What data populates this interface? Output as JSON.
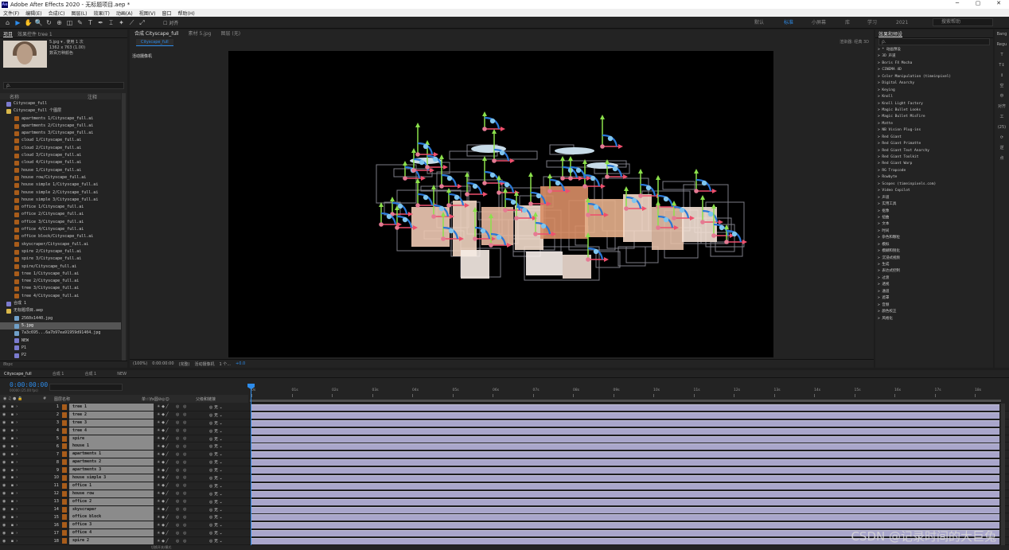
{
  "app": {
    "title": "Adobe After Effects 2020 - 无标题项目.aep *",
    "window_buttons": [
      "─",
      "▢",
      "✕"
    ]
  },
  "menu": [
    "文件(F)",
    "编辑(E)",
    "合成(C)",
    "图层(L)",
    "效果(T)",
    "动画(A)",
    "视图(V)",
    "窗口",
    "帮助(H)"
  ],
  "toolbar": {
    "tools": [
      "⌂",
      "▶",
      "✋",
      "🔍",
      "↻",
      "⊕",
      "◫",
      "✎",
      "T",
      "✒",
      "⌶",
      "✦",
      "⟋",
      "⤢"
    ],
    "extras": [
      "对齐"
    ],
    "workspaces": [
      "默认",
      "标准",
      "小屏幕",
      "库",
      "学习",
      "2021"
    ],
    "active_workspace": "标准",
    "search_help": "搜索帮助"
  },
  "project": {
    "tabs": [
      "项目",
      "效果控件 tree 1"
    ],
    "item_name": "5.jpg",
    "item_meta": [
      "5.jpg ▾ , 使用 1 次",
      "1362 x 763 (1.00)",
      "",
      "数百万种颜色"
    ],
    "search_placeholder": "ρ.",
    "col_name": "名称",
    "col_comment": "注释",
    "items": [
      {
        "label": "Cityscape_full",
        "type": "comp",
        "indent": 0
      },
      {
        "label": "Cityscape_full 个图层",
        "type": "folder",
        "indent": 0
      },
      {
        "label": "apartments 1/Cityscape_full.ai",
        "type": "ai",
        "indent": 1
      },
      {
        "label": "apartments 2/Cityscape_full.ai",
        "type": "ai",
        "indent": 1
      },
      {
        "label": "apartments 3/Cityscape_full.ai",
        "type": "ai",
        "indent": 1
      },
      {
        "label": "cloud 1/Cityscape_full.ai",
        "type": "ai",
        "indent": 1
      },
      {
        "label": "cloud 2/Cityscape_full.ai",
        "type": "ai",
        "indent": 1
      },
      {
        "label": "cloud 3/Cityscape_full.ai",
        "type": "ai",
        "indent": 1
      },
      {
        "label": "cloud 4/Cityscape_full.ai",
        "type": "ai",
        "indent": 1
      },
      {
        "label": "house 1/Cityscape_full.ai",
        "type": "ai",
        "indent": 1
      },
      {
        "label": "house row/Cityscape_full.ai",
        "type": "ai",
        "indent": 1
      },
      {
        "label": "house simple 1/Cityscape_full.ai",
        "type": "ai",
        "indent": 1
      },
      {
        "label": "house simple 2/Cityscape_full.ai",
        "type": "ai",
        "indent": 1
      },
      {
        "label": "house simple 3/Cityscape_full.ai",
        "type": "ai",
        "indent": 1
      },
      {
        "label": "office 1/Cityscape_full.ai",
        "type": "ai",
        "indent": 1
      },
      {
        "label": "office 2/Cityscape_full.ai",
        "type": "ai",
        "indent": 1
      },
      {
        "label": "office 3/Cityscape_full.ai",
        "type": "ai",
        "indent": 1
      },
      {
        "label": "office 4/Cityscape_full.ai",
        "type": "ai",
        "indent": 1
      },
      {
        "label": "office block/Cityscape_full.ai",
        "type": "ai",
        "indent": 1
      },
      {
        "label": "skyscraper/Cityscape_full.ai",
        "type": "ai",
        "indent": 1
      },
      {
        "label": "spire 2/Cityscape_full.ai",
        "type": "ai",
        "indent": 1
      },
      {
        "label": "spire 3/Cityscape_full.ai",
        "type": "ai",
        "indent": 1
      },
      {
        "label": "spire/Cityscape_full.ai",
        "type": "ai",
        "indent": 1
      },
      {
        "label": "tree 1/Cityscape_full.ai",
        "type": "ai",
        "indent": 1
      },
      {
        "label": "tree 2/Cityscape_full.ai",
        "type": "ai",
        "indent": 1
      },
      {
        "label": "tree 3/Cityscape_full.ai",
        "type": "ai",
        "indent": 1
      },
      {
        "label": "tree 4/Cityscape_full.ai",
        "type": "ai",
        "indent": 1
      },
      {
        "label": "合成 1",
        "type": "comp",
        "indent": 0
      },
      {
        "label": "无标题项目.aep",
        "type": "folder",
        "indent": 0
      },
      {
        "label": "2560x1440.jpg",
        "type": "img",
        "indent": 1
      },
      {
        "label": "5.jpg",
        "type": "img",
        "indent": 1,
        "selected": true
      },
      {
        "label": "7a3c695...6a7b97ea91959d91404.jpg",
        "type": "img",
        "indent": 1
      },
      {
        "label": "NEW",
        "type": "comp",
        "indent": 1
      },
      {
        "label": "P1",
        "type": "comp",
        "indent": 1
      },
      {
        "label": "P2",
        "type": "comp",
        "indent": 1
      }
    ],
    "footer": "8bpc"
  },
  "viewer": {
    "tabs": [
      "合成 Cityscape_full",
      "素材 5.jpg",
      "图层 (无)"
    ],
    "active_tab": "合成 Cityscape_full",
    "subtab": "Cityscape_full",
    "camera_label": "活动摄像机",
    "renderer": "渲染器: 经典 3D",
    "footer": [
      "(100%)",
      "0:00:00:00",
      "(完整)",
      "活动摄像机",
      "1 个...",
      "+0.0"
    ]
  },
  "effects": {
    "title": "效果和预设",
    "search_placeholder": "ρ.",
    "items": [
      "> * 动画预设",
      "> 3D 声道",
      "> Boris FX Mocha",
      "> CINEMA 4D",
      "> Color Manipulation (timeinpixel)",
      "> Digital Anarchy",
      "> Keying",
      "> Knoll",
      "> Knoll Light Factory",
      "> Magic Bullet Looks",
      "> Magic Bullet MisFire",
      "> Matte",
      "> NB Vision Plug-ins",
      "> Red Giant",
      "> Red Giant Primatte",
      "> Red Giant Text Anarchy",
      "> Red Giant Toolkit",
      "> Red Giant Warp",
      "> RG Trapcode",
      "> Rowbyte",
      "> Scopes (timeinpixels.com)",
      "> Video Copilot",
      "> 声道",
      "> 实用工具",
      "> 抠像",
      "> 扭曲",
      "> 文本",
      "> 时间",
      "> 杂色和颗粒",
      "> 模拟",
      "> 模糊和锐化",
      "> 沉浸式视频",
      "> 生成",
      "> 表达式控制",
      "> 过渡",
      "> 透视",
      "> 通道",
      "> 遮罩",
      "> 音频",
      "> 颜色校正",
      "> 风格化"
    ]
  },
  "right_strip": [
    "Bang",
    "Regu",
    "T",
    "T↕",
    "↕",
    "空",
    "中",
    "对齐",
    "工",
    "(25)",
    "⟳",
    "逆",
    "点"
  ],
  "timeline": {
    "tabs": [
      "Cityscape_full",
      "合成 1",
      "合成 1",
      "NEW"
    ],
    "active_tab": "Cityscape_full",
    "timecode": "0:00:00:00",
    "fps": "00000 (25.00 fps)",
    "header": {
      "num": "#",
      "name": "图层名称",
      "switches": "单☆\\fx圆⊘◎☺",
      "parent": "父级和链接"
    },
    "ticks": [
      "0s",
      "01s",
      "02s",
      "03s",
      "04s",
      "05s",
      "06s",
      "07s",
      "08s",
      "09s",
      "10s",
      "11s",
      "12s",
      "13s",
      "14s",
      "15s",
      "16s",
      "17s",
      "18s"
    ],
    "layers": [
      {
        "num": "1",
        "name": "tree 1",
        "parent": "无"
      },
      {
        "num": "2",
        "name": "tree 2",
        "parent": "无"
      },
      {
        "num": "3",
        "name": "tree 3",
        "parent": "无"
      },
      {
        "num": "4",
        "name": "tree 4",
        "parent": "无"
      },
      {
        "num": "5",
        "name": "spire",
        "parent": "无"
      },
      {
        "num": "6",
        "name": "house 1",
        "parent": "无"
      },
      {
        "num": "7",
        "name": "apartments 1",
        "parent": "无"
      },
      {
        "num": "8",
        "name": "apartments 2",
        "parent": "无"
      },
      {
        "num": "9",
        "name": "apartments 3",
        "parent": "无"
      },
      {
        "num": "10",
        "name": "house simple 3",
        "parent": "无"
      },
      {
        "num": "11",
        "name": "office 1",
        "parent": "无"
      },
      {
        "num": "12",
        "name": "house row",
        "parent": "无"
      },
      {
        "num": "13",
        "name": "office 2",
        "parent": "无"
      },
      {
        "num": "14",
        "name": "skyscraper",
        "parent": "无"
      },
      {
        "num": "15",
        "name": "office block",
        "parent": "无"
      },
      {
        "num": "16",
        "name": "office 3",
        "parent": "无"
      },
      {
        "num": "17",
        "name": "office 4",
        "parent": "无"
      },
      {
        "num": "18",
        "name": "spire 2",
        "parent": "无"
      }
    ],
    "footer": "切换开关/模式"
  },
  "watermark": "CSDN @记录时间的大巨兔",
  "colors": {
    "accent": "#2d8ceb",
    "layer_bar": "#a9a6cb",
    "label_orange": "#a85c1a"
  }
}
